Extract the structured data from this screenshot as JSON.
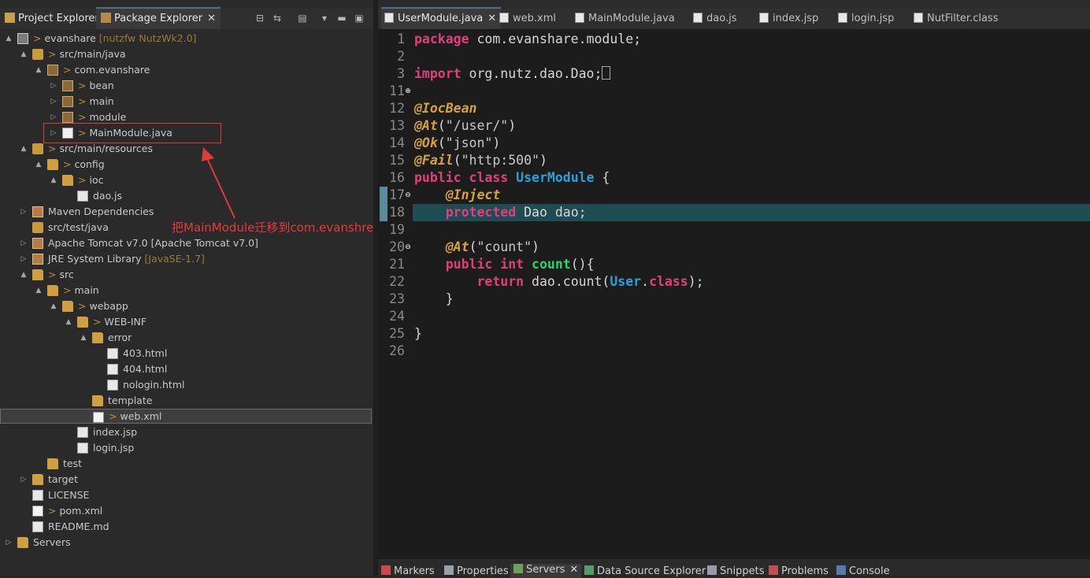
{
  "left_panel": {
    "tabs": [
      {
        "label": "Project Explorer",
        "icon": "project-explorer-icon"
      },
      {
        "label": "Package Explorer",
        "icon": "package-explorer-icon",
        "active": true
      }
    ],
    "toolbar": [
      "collapse-all-icon",
      "link-editor-icon",
      "filter-icon",
      "view-menu-icon",
      "minimize-icon",
      "maximize-icon"
    ],
    "tree": [
      {
        "depth": 0,
        "tw": "▲",
        "icon": "proj",
        "prefix": ">",
        "label": "evanshare",
        "suffix": "[nutzfw NutzWk2.0]"
      },
      {
        "depth": 1,
        "tw": "▲",
        "icon": "srcf",
        "prefix": ">",
        "label": "src/main/java"
      },
      {
        "depth": 2,
        "tw": "▲",
        "icon": "pkg",
        "prefix": ">",
        "label": "com.evanshare"
      },
      {
        "depth": 3,
        "tw": "▷",
        "icon": "pkg",
        "prefix": ">",
        "label": "bean"
      },
      {
        "depth": 3,
        "tw": "▷",
        "icon": "pkg",
        "prefix": ">",
        "label": "main"
      },
      {
        "depth": 3,
        "tw": "▷",
        "icon": "pkg",
        "prefix": ">",
        "label": "module"
      },
      {
        "depth": 3,
        "tw": "▷",
        "icon": "java",
        "prefix": ">",
        "label": "MainModule.java"
      },
      {
        "depth": 1,
        "tw": "▲",
        "icon": "srcf",
        "prefix": ">",
        "label": "src/main/resources"
      },
      {
        "depth": 2,
        "tw": "▲",
        "icon": "fold",
        "prefix": ">",
        "label": "config"
      },
      {
        "depth": 3,
        "tw": "▲",
        "icon": "fold",
        "prefix": ">",
        "label": "ioc"
      },
      {
        "depth": 4,
        "tw": "",
        "icon": "file",
        "prefix": "",
        "label": "dao.js"
      },
      {
        "depth": 1,
        "tw": "▷",
        "icon": "lib",
        "prefix": "",
        "label": "Maven Dependencies"
      },
      {
        "depth": 1,
        "tw": "",
        "icon": "srcf",
        "prefix": "",
        "label": "src/test/java"
      },
      {
        "depth": 1,
        "tw": "▷",
        "icon": "lib",
        "prefix": "",
        "label": "Apache Tomcat v7.0 [Apache Tomcat v7.0]"
      },
      {
        "depth": 1,
        "tw": "▷",
        "icon": "lib",
        "prefix": "",
        "label": "JRE System Library",
        "suffix": "[JavaSE-1.7]"
      },
      {
        "depth": 1,
        "tw": "▲",
        "icon": "fold",
        "prefix": ">",
        "label": "src"
      },
      {
        "depth": 2,
        "tw": "▲",
        "icon": "fold",
        "prefix": ">",
        "label": "main"
      },
      {
        "depth": 3,
        "tw": "▲",
        "icon": "fold",
        "prefix": ">",
        "label": "webapp"
      },
      {
        "depth": 4,
        "tw": "▲",
        "icon": "fold",
        "prefix": ">",
        "label": "WEB-INF"
      },
      {
        "depth": 5,
        "tw": "▲",
        "icon": "fold",
        "prefix": "",
        "label": "error"
      },
      {
        "depth": 6,
        "tw": "",
        "icon": "file",
        "prefix": "",
        "label": "403.html"
      },
      {
        "depth": 6,
        "tw": "",
        "icon": "file",
        "prefix": "",
        "label": "404.html"
      },
      {
        "depth": 6,
        "tw": "",
        "icon": "file",
        "prefix": "",
        "label": "nologin.html"
      },
      {
        "depth": 5,
        "tw": "",
        "icon": "fold",
        "prefix": "",
        "label": "template"
      },
      {
        "depth": 5,
        "tw": "",
        "icon": "xml",
        "prefix": ">",
        "label": "web.xml",
        "selected": true
      },
      {
        "depth": 4,
        "tw": "",
        "icon": "file",
        "prefix": "",
        "label": "index.jsp"
      },
      {
        "depth": 4,
        "tw": "",
        "icon": "file",
        "prefix": "",
        "label": "login.jsp"
      },
      {
        "depth": 2,
        "tw": "",
        "icon": "fold",
        "prefix": "",
        "label": "test"
      },
      {
        "depth": 1,
        "tw": "▷",
        "icon": "fold",
        "prefix": "",
        "label": "target"
      },
      {
        "depth": 1,
        "tw": "",
        "icon": "file",
        "prefix": "",
        "label": "LICENSE"
      },
      {
        "depth": 1,
        "tw": "",
        "icon": "xml",
        "prefix": ">",
        "label": "pom.xml"
      },
      {
        "depth": 1,
        "tw": "",
        "icon": "file",
        "prefix": "",
        "label": "README.md"
      },
      {
        "depth": 0,
        "tw": "▷",
        "icon": "fold",
        "prefix": "",
        "label": "Servers"
      }
    ],
    "annotation": "把MainModule迁移到com.evanshre目录下"
  },
  "editor": {
    "tabs": [
      {
        "label": "UserModule.java",
        "active": true
      },
      {
        "label": "web.xml"
      },
      {
        "label": "MainModule.java"
      },
      {
        "label": "dao.js"
      },
      {
        "label": "index.jsp"
      },
      {
        "label": "login.jsp"
      },
      {
        "label": "NutFilter.class"
      }
    ],
    "line_numbers": [
      "1",
      "2",
      "3",
      "11",
      "12",
      "13",
      "14",
      "15",
      "16",
      "17",
      "18",
      "19",
      "20",
      "21",
      "22",
      "23",
      "24",
      "25",
      "26"
    ]
  },
  "bottom_tabs": [
    {
      "label": "Markers"
    },
    {
      "label": "Properties"
    },
    {
      "label": "Servers",
      "active": true
    },
    {
      "label": "Data Source Explorer"
    },
    {
      "label": "Snippets"
    },
    {
      "label": "Problems"
    },
    {
      "label": "Console"
    }
  ]
}
